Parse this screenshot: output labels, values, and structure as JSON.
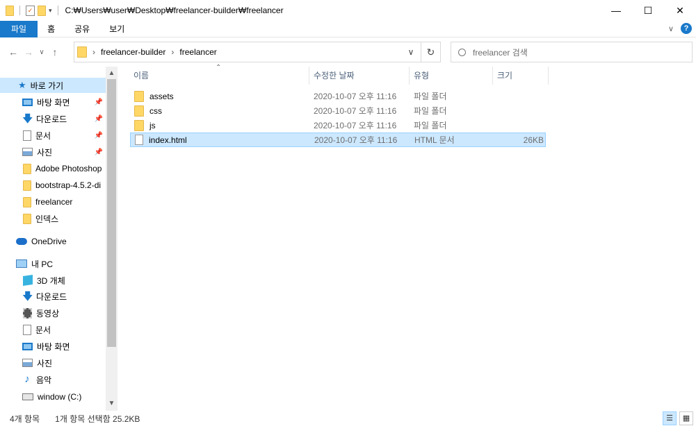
{
  "window": {
    "path": "C:₩Users₩user₩Desktop₩freelancer-builder₩freelancer",
    "minimize": "—",
    "maximize": "☐",
    "close": "✕"
  },
  "ribbon": {
    "tabs": [
      "파일",
      "홈",
      "공유",
      "보기"
    ],
    "expand": "∨",
    "help": "?"
  },
  "address": {
    "crumbs": [
      "freelancer-builder",
      "freelancer"
    ],
    "separator": "›",
    "dropdown": "∨",
    "refresh": "↻",
    "search_placeholder": "freelancer 검색"
  },
  "nav": {
    "back": "←",
    "forward": "→",
    "recent": "∨",
    "up": "↑"
  },
  "sidebar": {
    "quick_access": "바로 가기",
    "items": [
      {
        "label": "바탕 화면",
        "icon": "desktop-icon",
        "pinned": true
      },
      {
        "label": "다운로드",
        "icon": "download-icon",
        "pinned": true
      },
      {
        "label": "문서",
        "icon": "documents-icon",
        "pinned": true
      },
      {
        "label": "사진",
        "icon": "pictures-icon",
        "pinned": true
      },
      {
        "label": "Adobe Photoshop",
        "icon": "folder-icon"
      },
      {
        "label": "bootstrap-4.5.2-di",
        "icon": "folder-icon"
      },
      {
        "label": "freelancer",
        "icon": "folder-icon"
      },
      {
        "label": "인덱스",
        "icon": "folder-icon"
      }
    ],
    "onedrive": "OneDrive",
    "this_pc": "내 PC",
    "pc_items": [
      {
        "label": "3D 개체",
        "icon": "3d-objects-icon"
      },
      {
        "label": "다운로드",
        "icon": "download-icon"
      },
      {
        "label": "동영상",
        "icon": "videos-icon"
      },
      {
        "label": "문서",
        "icon": "documents-icon"
      },
      {
        "label": "바탕 화면",
        "icon": "desktop-icon"
      },
      {
        "label": "사진",
        "icon": "pictures-icon"
      },
      {
        "label": "음악",
        "icon": "music-icon"
      },
      {
        "label": "window (C:)",
        "icon": "drive-icon"
      }
    ]
  },
  "columns": {
    "name": "이름",
    "date": "수정한 날짜",
    "type": "유형",
    "size": "크기"
  },
  "files": [
    {
      "name": "assets",
      "date": "2020-10-07 오후 11:16",
      "type": "파일 폴더",
      "size": "",
      "kind": "folder"
    },
    {
      "name": "css",
      "date": "2020-10-07 오후 11:16",
      "type": "파일 폴더",
      "size": "",
      "kind": "folder"
    },
    {
      "name": "js",
      "date": "2020-10-07 오후 11:16",
      "type": "파일 폴더",
      "size": "",
      "kind": "folder"
    },
    {
      "name": "index.html",
      "date": "2020-10-07 오후 11:16",
      "type": "HTML 문서",
      "size": "26KB",
      "kind": "file",
      "selected": true
    }
  ],
  "status": {
    "count": "4개 항목",
    "selection": "1개 항목 선택함 25.2KB"
  },
  "colors": {
    "accent": "#1979ca",
    "selection": "#cce8ff",
    "folder": "#ffd766"
  }
}
